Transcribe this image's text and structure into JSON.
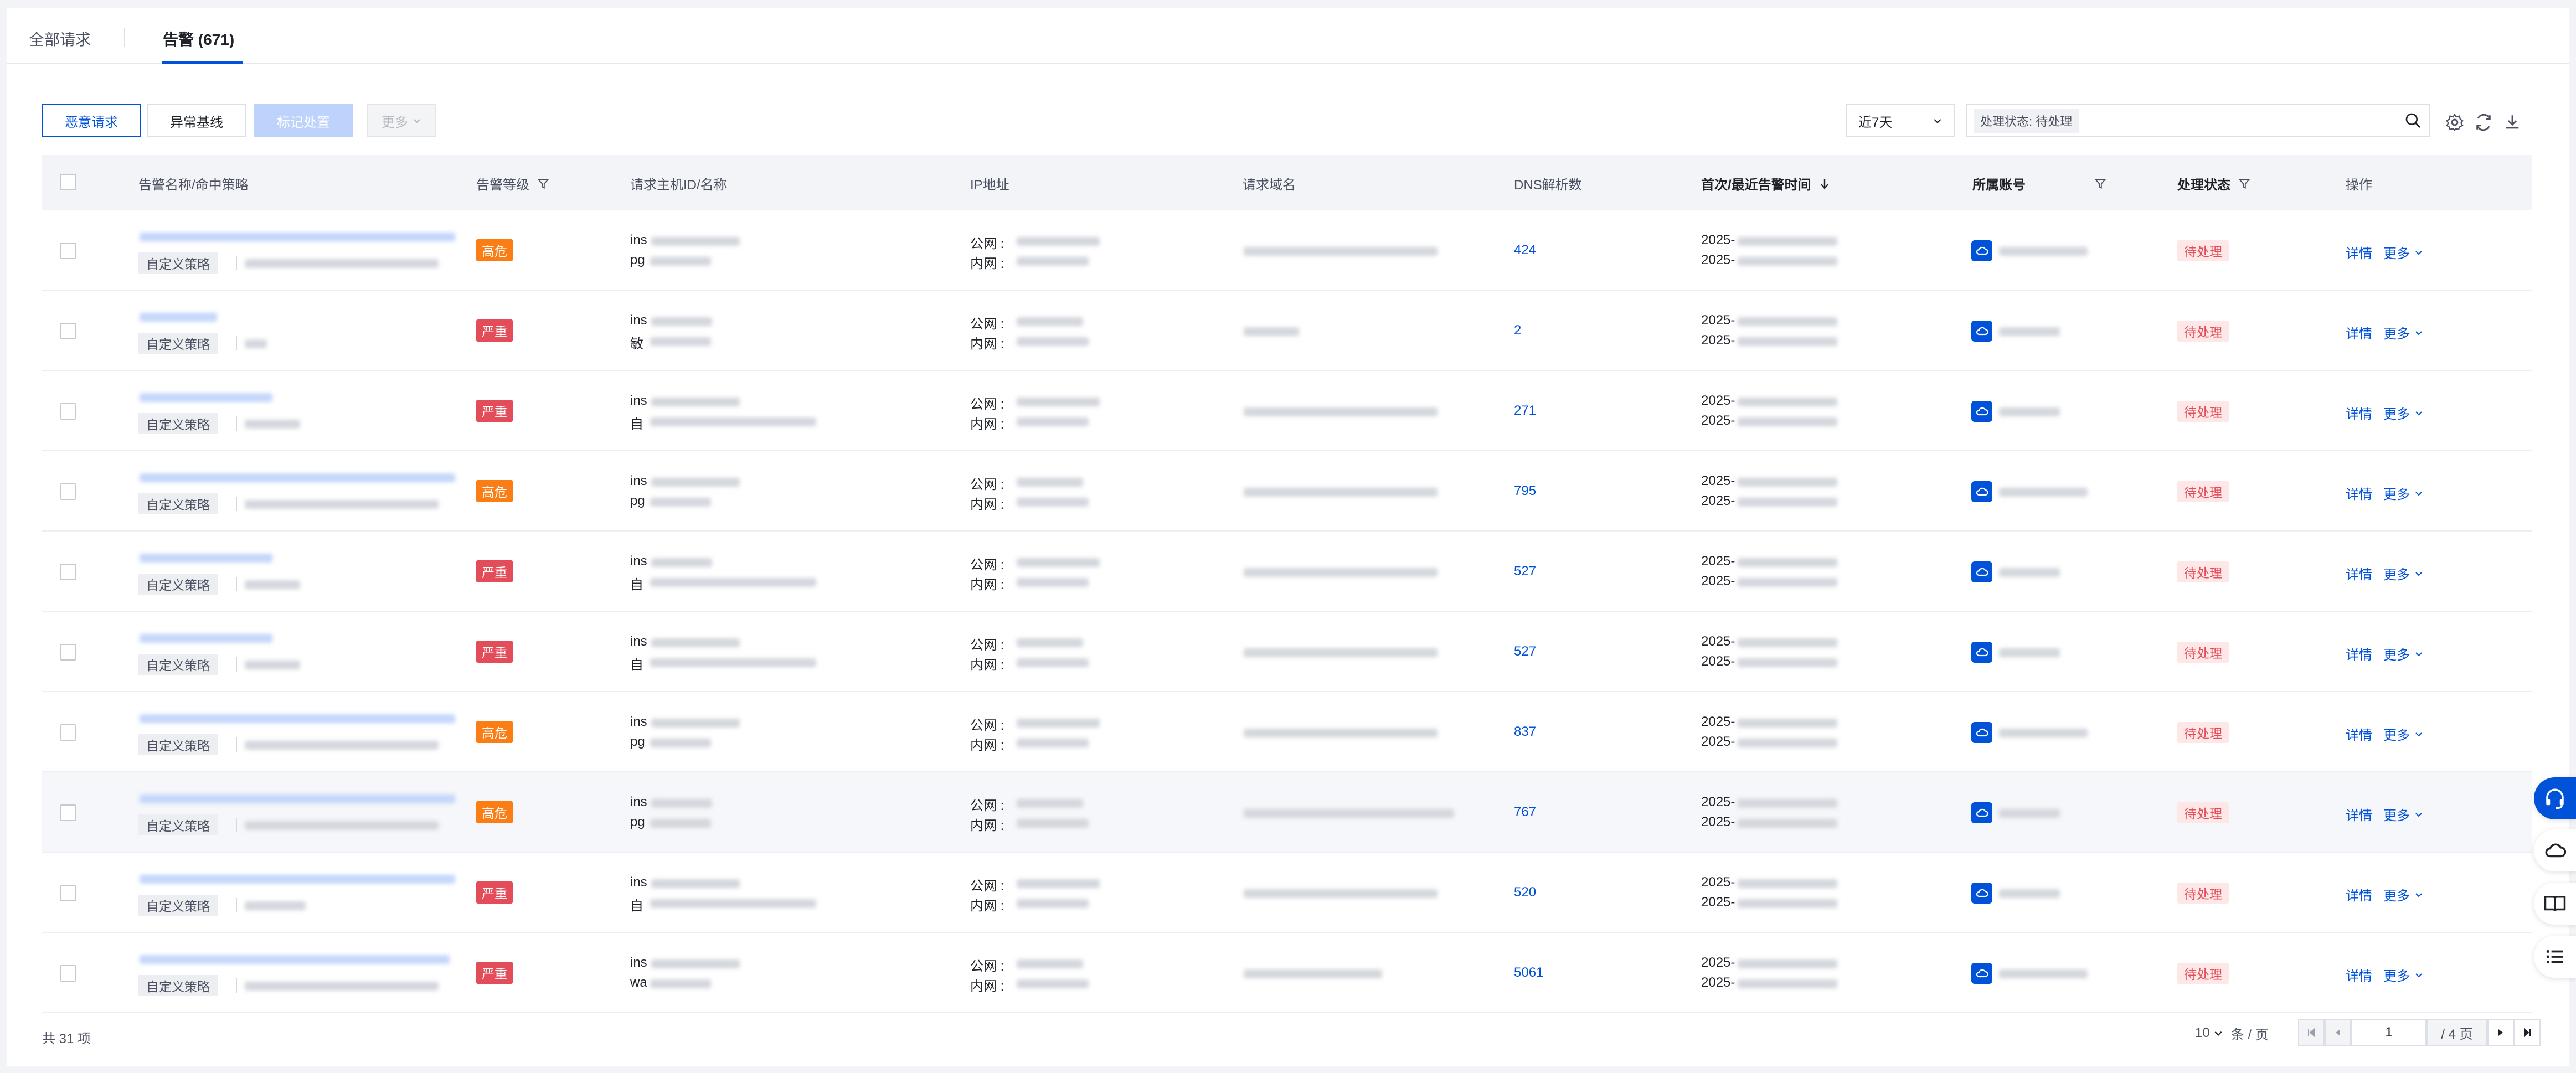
{
  "tabs": [
    {
      "label": "全部请求",
      "active": false
    },
    {
      "label": "告警 (671)",
      "active": true
    }
  ],
  "toolbar": {
    "btn_malicious": "恶意请求",
    "btn_baseline": "异常基线",
    "btn_mark": "标记处置",
    "btn_more": "更多",
    "time_range": "近7天",
    "filter_chip": "处理状态: 待处理"
  },
  "columns": {
    "name": "告警名称/命中策略",
    "level": "告警等级",
    "host": "请求主机ID/名称",
    "ip": "IP地址",
    "domain": "请求域名",
    "dns": "DNS解析数",
    "time": "首次/最近告警时间",
    "account": "所属账号",
    "status": "处理状态",
    "op": "操作"
  },
  "common": {
    "strategy_tag": "自定义策略",
    "ip_public": "公网 :",
    "ip_private": "内网 :",
    "time_prefix": "2025-",
    "detail": "详情",
    "more": "更多"
  },
  "rows": [
    {
      "level": "高危",
      "host_line1": "ins",
      "host_line2": "pg",
      "dns": "424",
      "status": "待处理"
    },
    {
      "level": "严重",
      "host_line1": "ins",
      "host_line2": "敏",
      "dns": "2",
      "status": "待处理"
    },
    {
      "level": "严重",
      "host_line1": "ins",
      "host_line2": "自",
      "dns": "271",
      "status": "待处理"
    },
    {
      "level": "高危",
      "host_line1": "ins",
      "host_line2": "pg",
      "dns": "795",
      "status": "待处理"
    },
    {
      "level": "严重",
      "host_line1": "ins",
      "host_line2": "自",
      "dns": "527",
      "status": "待处理"
    },
    {
      "level": "严重",
      "host_line1": "ins",
      "host_line2": "自",
      "dns": "527",
      "status": "待处理"
    },
    {
      "level": "高危",
      "host_line1": "ins",
      "host_line2": "pg",
      "dns": "837",
      "status": "待处理"
    },
    {
      "level": "高危",
      "host_line1": "ins",
      "host_line2": "pg",
      "dns": "767",
      "status": "待处理"
    },
    {
      "level": "严重",
      "host_line1": "ins",
      "host_line2": "自",
      "dns": "520",
      "status": "待处理"
    },
    {
      "level": "严重",
      "host_line1": "ins",
      "host_line2": "wa",
      "dns": "5061",
      "status": "待处理"
    }
  ],
  "footer": {
    "total": "共 31 项",
    "page_size": "10",
    "per_page_unit": "条 / 页",
    "current_page": "1",
    "total_pages": "/ 4 页"
  },
  "colors": {
    "primary": "#0052d9",
    "level_high": "#fa7d16",
    "level_critical": "#e34d59",
    "status_bg": "#fde7e7"
  }
}
